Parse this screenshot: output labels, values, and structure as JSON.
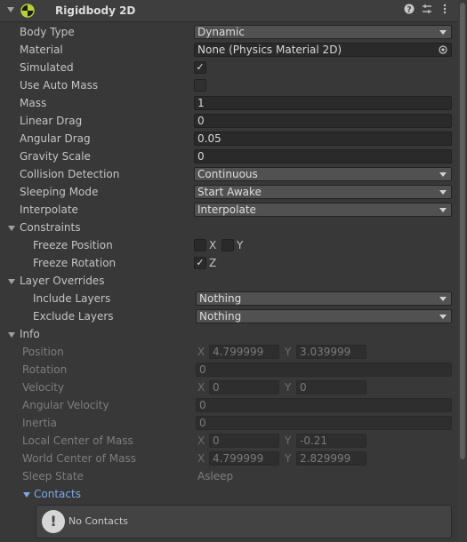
{
  "header": {
    "title": "Rigidbody 2D",
    "icons": [
      "help-icon",
      "preset-icon",
      "kebab-menu-icon"
    ]
  },
  "fields": {
    "body_type": {
      "label": "Body Type",
      "value": "Dynamic"
    },
    "material": {
      "label": "Material",
      "value": "None (Physics Material 2D)"
    },
    "simulated": {
      "label": "Simulated",
      "checked": true
    },
    "use_auto_mass": {
      "label": "Use Auto Mass",
      "checked": false
    },
    "mass": {
      "label": "Mass",
      "value": "1"
    },
    "linear_drag": {
      "label": "Linear Drag",
      "value": "0"
    },
    "angular_drag": {
      "label": "Angular Drag",
      "value": "0.05"
    },
    "gravity_scale": {
      "label": "Gravity Scale",
      "value": "0"
    },
    "collision_detection": {
      "label": "Collision Detection",
      "value": "Continuous"
    },
    "sleeping_mode": {
      "label": "Sleeping Mode",
      "value": "Start Awake"
    },
    "interpolate": {
      "label": "Interpolate",
      "value": "Interpolate"
    }
  },
  "constraints": {
    "label": "Constraints",
    "freeze_position": {
      "label": "Freeze Position",
      "x_label": "X",
      "y_label": "Y",
      "x": false,
      "y": false
    },
    "freeze_rotation": {
      "label": "Freeze Rotation",
      "z_label": "Z",
      "z": true
    }
  },
  "layer_overrides": {
    "label": "Layer Overrides",
    "include_layers": {
      "label": "Include Layers",
      "value": "Nothing"
    },
    "exclude_layers": {
      "label": "Exclude Layers",
      "value": "Nothing"
    }
  },
  "info": {
    "label": "Info",
    "axis_x": "X",
    "axis_y": "Y",
    "position": {
      "label": "Position",
      "x": "4.799999",
      "y": "3.039999"
    },
    "rotation": {
      "label": "Rotation",
      "value": "0"
    },
    "velocity": {
      "label": "Velocity",
      "x": "0",
      "y": "0"
    },
    "angular_velocity": {
      "label": "Angular Velocity",
      "value": "0"
    },
    "inertia": {
      "label": "Inertia",
      "value": "0"
    },
    "local_center_of_mass": {
      "label": "Local Center of Mass",
      "x": "0",
      "y": "-0.21"
    },
    "world_center_of_mass": {
      "label": "World Center of Mass",
      "x": "4.799999",
      "y": "2.829999"
    },
    "sleep_state": {
      "label": "Sleep State",
      "value": "Asleep"
    },
    "contacts": {
      "label": "Contacts",
      "message": "No Contacts"
    }
  },
  "check_glyph": "✓",
  "help_glyph": "!"
}
